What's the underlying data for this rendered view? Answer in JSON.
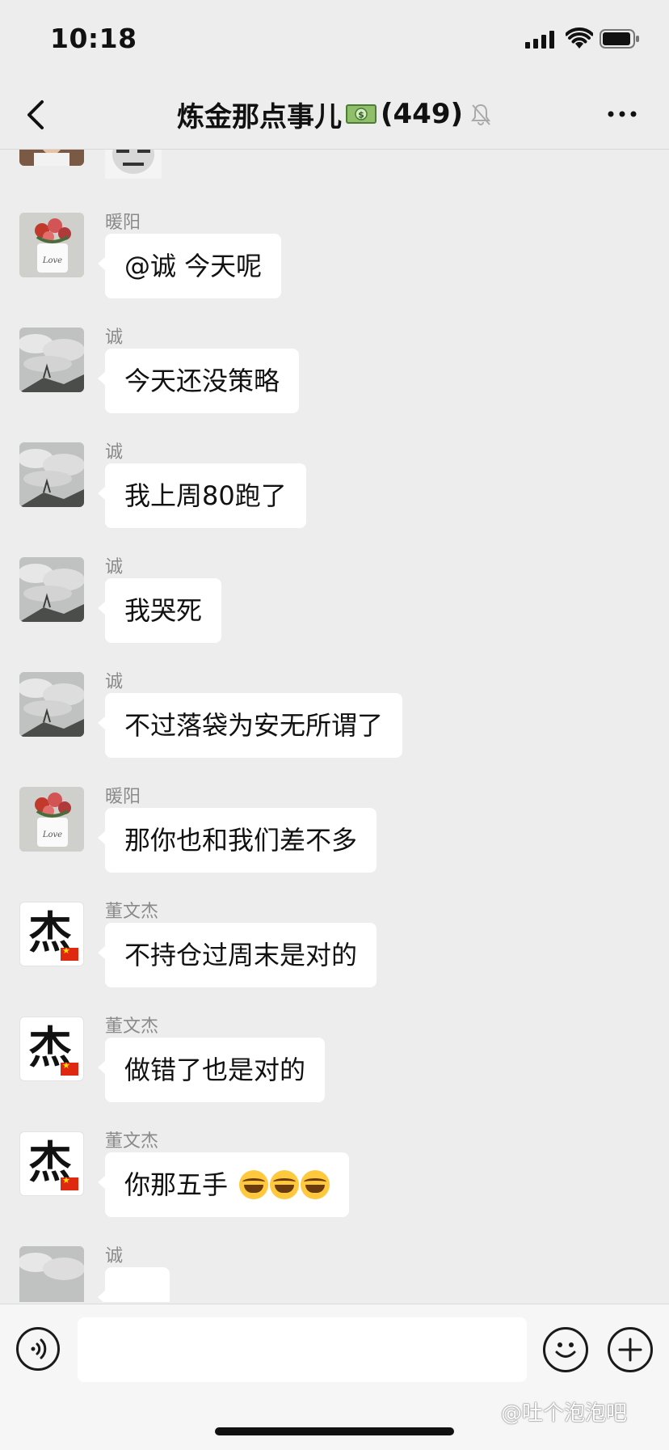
{
  "status_bar": {
    "time": "10:18"
  },
  "nav": {
    "title": "炼金那点事儿",
    "title_icon": "money-banknote-icon",
    "member_count": "(449)",
    "back_icon": "back-chevron-icon",
    "mute_icon": "bell-muted-icon",
    "more_icon": "more-dots-icon"
  },
  "messages": [
    {
      "sender": "暖阳",
      "avatar": "flower-pot-avatar",
      "text": "@诚 今天呢"
    },
    {
      "sender": "诚",
      "avatar": "sky-clouds-avatar",
      "text": "今天还没策略"
    },
    {
      "sender": "诚",
      "avatar": "sky-clouds-avatar",
      "text": "我上周80跑了"
    },
    {
      "sender": "诚",
      "avatar": "sky-clouds-avatar",
      "text": "我哭死"
    },
    {
      "sender": "诚",
      "avatar": "sky-clouds-avatar",
      "text": "不过落袋为安无所谓了"
    },
    {
      "sender": "暖阳",
      "avatar": "flower-pot-avatar",
      "text": "那你也和我们差不多"
    },
    {
      "sender": "董文杰",
      "avatar": "jie-character-avatar",
      "avatar_glyph": "杰",
      "text": "不持仓过周末是对的"
    },
    {
      "sender": "董文杰",
      "avatar": "jie-character-avatar",
      "avatar_glyph": "杰",
      "text": "做错了也是对的"
    },
    {
      "sender": "董文杰",
      "avatar": "jie-character-avatar",
      "avatar_glyph": "杰",
      "text": "你那五手",
      "emojis": [
        "crying-laughing-emoji",
        "crying-laughing-emoji",
        "crying-laughing-emoji"
      ]
    },
    {
      "sender": "诚",
      "avatar": "sky-clouds-avatar",
      "text": ""
    }
  ],
  "input_bar": {
    "voice_icon": "voice-icon",
    "input_placeholder": "",
    "emoji_icon": "smiley-icon",
    "plus_icon": "plus-icon"
  },
  "watermark": "@吐个泡泡吧",
  "colors": {
    "background": "#EDEDED",
    "bubble": "#FFFFFF",
    "name": "#8A8A8A"
  }
}
